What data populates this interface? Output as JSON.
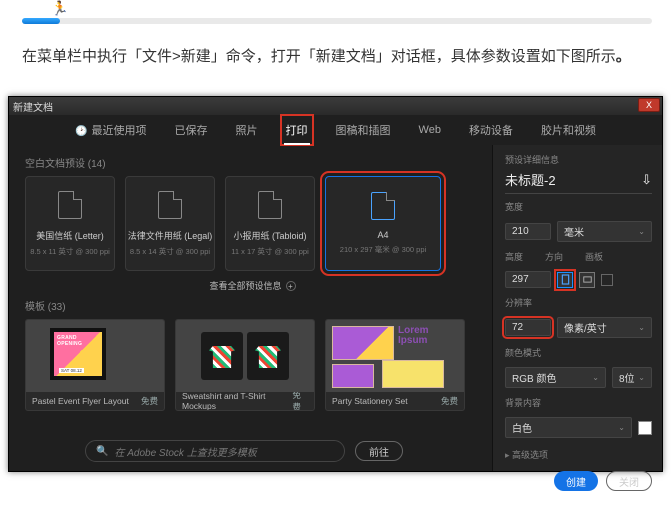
{
  "caption": "在菜单栏中执行「文件>新建」命令，打开「新建文档」对话框，具体参数设置如下图所示",
  "runner_glyph": "🏃",
  "dialog": {
    "title": "新建文档",
    "close_glyph": "X",
    "tabs": {
      "recent": "最近使用项",
      "saved": "已保存",
      "photo": "照片",
      "print": "打印",
      "art": "图稿和插图",
      "web": "Web",
      "mobile": "移动设备",
      "film": "胶片和视频"
    },
    "blank_section": "空白文档预设 (14)",
    "presets": [
      {
        "name": "美国信纸 (Letter)",
        "dim": "8.5 x 11 英寸 @ 300 ppi"
      },
      {
        "name": "法律文件用纸 (Legal)",
        "dim": "8.5 x 14 英寸 @ 300 ppi"
      },
      {
        "name": "小报用纸 (Tabloid)",
        "dim": "11 x 17 英寸 @ 300 ppi"
      },
      {
        "name": "A4",
        "dim": "210 x 297 毫米 @ 300 ppi"
      }
    ],
    "more_presets": "查看全部预设信息",
    "templates_section": "模板 (33)",
    "templates": [
      {
        "name": "Pastel Event Flyer Layout",
        "badge": "免费"
      },
      {
        "name": "Sweatshirt and T-Shirt Mockups",
        "badge": "免费"
      },
      {
        "name": "Party Stationery Set",
        "badge": "免费"
      }
    ],
    "lorem": "Lorem Ipsum",
    "search": {
      "placeholder": "在 Adobe Stock 上查找更多模板",
      "go": "前往",
      "mag": "🔍"
    }
  },
  "panel": {
    "header": "预设详细信息",
    "docname": "未标题-2",
    "save_glyph": "⇩",
    "w_label": "宽度",
    "w_val": "210",
    "unit": "毫米",
    "h_label": "高度",
    "h_val": "297",
    "orient_label": "方向",
    "artboard_label": "画板",
    "res_label": "分辨率",
    "res_val": "72",
    "res_unit": "像素/英寸",
    "mode_label": "颜色模式",
    "mode_val": "RGB 颜色",
    "bits": "8位",
    "bg_label": "背景内容",
    "bg_val": "白色",
    "advanced": "高级选项",
    "create": "创建",
    "close": "关闭",
    "chev": "⌄"
  }
}
